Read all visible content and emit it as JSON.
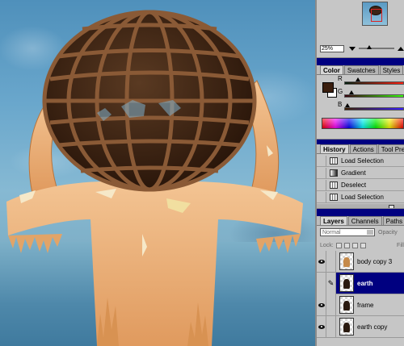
{
  "navigator": {
    "zoom": "25%"
  },
  "color_panel": {
    "tabs": [
      "Color",
      "Swatches",
      "Styles"
    ],
    "active_tab": "Color",
    "foreground": "#3a1e0e",
    "background": "#ffffff",
    "channels": [
      {
        "label": "R",
        "value": 58,
        "gradient": "linear-gradient(90deg,#001e0e,#ff1e0e)"
      },
      {
        "label": "G",
        "value": 30,
        "gradient": "linear-gradient(90deg,#3a000e,#3aff0e)"
      },
      {
        "label": "B",
        "value": 14,
        "gradient": "linear-gradient(90deg,#3a1e00,#3a1eff)"
      }
    ]
  },
  "history_panel": {
    "tabs": [
      "History",
      "Actions",
      "Tool Presets"
    ],
    "active_tab": "History",
    "items": [
      {
        "label": "Load Selection",
        "icon": "selection-icon"
      },
      {
        "label": "Gradient",
        "icon": "gradient-icon"
      },
      {
        "label": "Deselect",
        "icon": "selection-icon"
      },
      {
        "label": "Load Selection",
        "icon": "selection-icon"
      }
    ]
  },
  "layers_panel": {
    "tabs": [
      "Layers",
      "Channels",
      "Paths"
    ],
    "active_tab": "Layers",
    "blend_mode": "Normal",
    "opacity_label": "Opacity",
    "lock_label": "Lock:",
    "fill_label": "Fill",
    "layers": [
      {
        "name": "body copy 3",
        "visible": true,
        "selected": false,
        "thumb": "light"
      },
      {
        "name": "earth",
        "visible": false,
        "selected": true,
        "thumb": "dark"
      },
      {
        "name": "frame",
        "visible": true,
        "selected": false,
        "thumb": "dark"
      },
      {
        "name": "earth copy",
        "visible": true,
        "selected": false,
        "thumb": "dark"
      }
    ]
  }
}
